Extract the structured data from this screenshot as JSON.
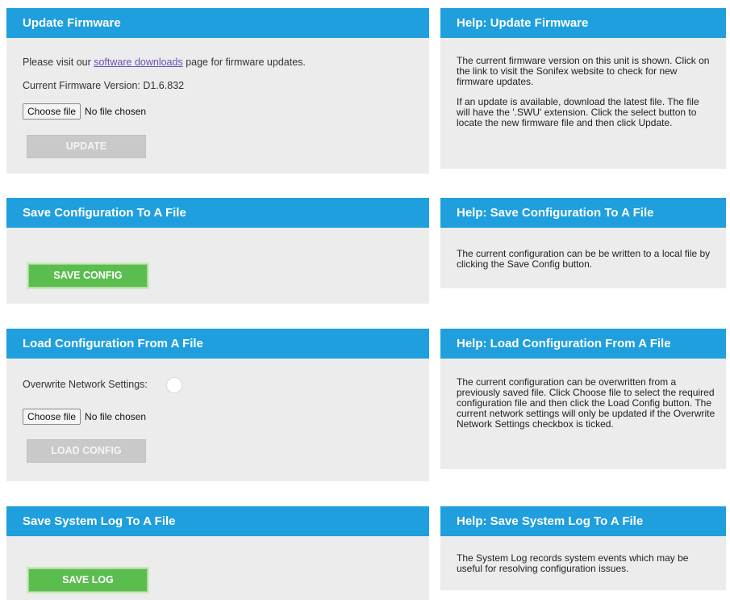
{
  "firmware": {
    "title": "Update Firmware",
    "visit_prefix": "Please visit our ",
    "visit_link": "software downloads",
    "visit_suffix": " page for firmware updates.",
    "version_label": "Current Firmware Version:",
    "version_value": "D1.6.832",
    "choose_file_label": "Choose file",
    "file_status": "No file chosen",
    "update_button": "UPDATE"
  },
  "firmware_help": {
    "title": "Help: Update Firmware",
    "paragraph1": "The current firmware version on this unit is shown. Click on the link to visit the Sonifex website to check for new firmware updates.",
    "paragraph2": "If an update is available, download the latest file. The file will have the '.SWU' extension. Click the select button to locate the new firmware file and then click Update."
  },
  "save_config": {
    "title": "Save Configuration To A File",
    "button": "SAVE CONFIG"
  },
  "save_config_help": {
    "title": "Help: Save Configuration To A File",
    "paragraph1": "The current configuration can be be written to a local file by clicking the Save Config button."
  },
  "load_config": {
    "title": "Load Configuration From A File",
    "overwrite_label": "Overwrite Network Settings:",
    "overwrite_checked": false,
    "choose_file_label": "Choose file",
    "file_status": "No file chosen",
    "button": "LOAD CONFIG"
  },
  "load_config_help": {
    "title": "Help: Load Configuration From A File",
    "paragraph1": "The current configuration can be overwritten from a previously saved file. Click Choose file to select the required configuration file and then click the Load Config button. The current network settings will only be updated if the Overwrite Network Settings checkbox is ticked."
  },
  "save_log": {
    "title": "Save System Log To A File",
    "button": "SAVE LOG"
  },
  "save_log_help": {
    "title": "Help: Save System Log To A File",
    "paragraph1": "The System Log records system events which may be useful for resolving configuration issues."
  },
  "colors": {
    "header_blue": "#1f9fdd",
    "panel_grey": "#ececec",
    "button_green": "#5cbd4f",
    "button_disabled": "#c9c9c9",
    "link_purple": "#6a4fb3"
  }
}
